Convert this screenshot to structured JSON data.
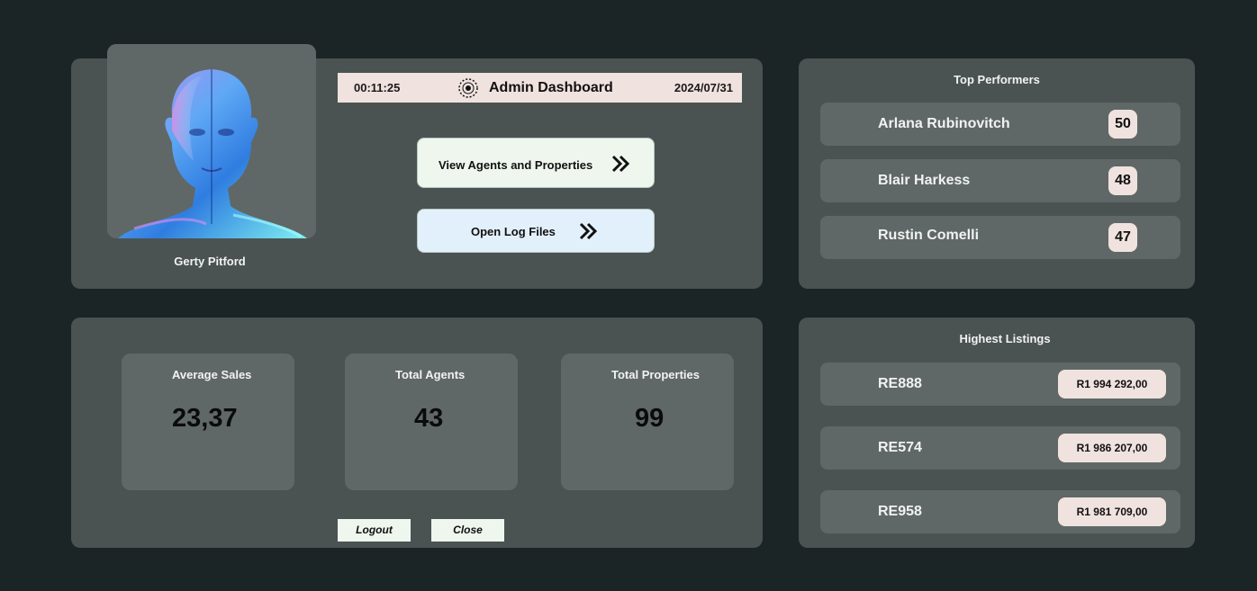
{
  "profile": {
    "name": "Gerty Pitford"
  },
  "header": {
    "time": "00:11:25",
    "title": "Admin Dashboard",
    "date": "2024/07/31",
    "icon": "target-icon"
  },
  "nav": {
    "agents_label": "View Agents and Properties",
    "logs_label": "Open Log Files"
  },
  "stats": [
    {
      "label": "Average Sales",
      "value": "23,37"
    },
    {
      "label": "Total Agents",
      "value": "43"
    },
    {
      "label": "Total Properties",
      "value": "99"
    }
  ],
  "actions": {
    "logout_label": "Logout",
    "close_label": "Close"
  },
  "top_performers": {
    "title": "Top Performers",
    "items": [
      {
        "name": "Arlana Rubinovitch",
        "score": "50"
      },
      {
        "name": "Blair Harkess",
        "score": "48"
      },
      {
        "name": "Rustin Comelli",
        "score": "47"
      }
    ]
  },
  "highest_listings": {
    "title": "Highest Listings",
    "items": [
      {
        "code": "RE888",
        "price": "R1 994 292,00"
      },
      {
        "code": "RE574",
        "price": "R1 986 207,00"
      },
      {
        "code": "RE958",
        "price": "R1 981 709,00"
      }
    ]
  },
  "colors": {
    "background": "#1c2526",
    "panel": "#4a5352",
    "card": "#5f6866",
    "accent": "#f0e2de"
  }
}
